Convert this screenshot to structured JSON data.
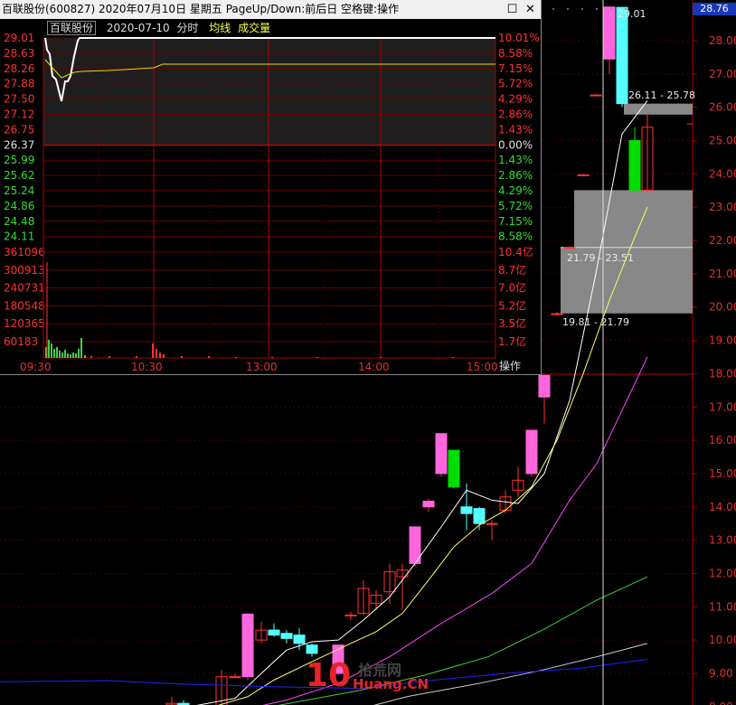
{
  "main_chart": {
    "price_axis_labels": [
      "28.00",
      "27.00",
      "26.00",
      "25.00",
      "24.00",
      "23.00",
      "22.00",
      "21.00",
      "20.00",
      "19.00",
      "18.00",
      "17.00",
      "16.00",
      "15.00",
      "14.00",
      "13.00",
      "12.00",
      "11.00",
      "10.00",
      "9.00",
      "8.00"
    ],
    "current_price_tag": "28.76",
    "high_label": "29.01",
    "range_labels": [
      "26.11 - 25.78",
      "21.79 - 23.51",
      "19.81 - 21.79"
    ],
    "colors": {
      "up": "#ff3232",
      "up_fill": "#ff66dd",
      "down": "#54ffff",
      "down_fill": "#00dd00",
      "ma5": "#ffffff",
      "ma10": "#ffff66",
      "ma20": "#ff44ff",
      "ma60": "#44cc44",
      "ma120": "#cccccc",
      "ma250": "#2222ff"
    }
  },
  "popup": {
    "title": "百联股份(600827) 2020年07月10日 星期五 PageUp/Down:前后日 空格键:操作",
    "min_button": "☐",
    "close_button": "✕",
    "stock_name": "百联股份",
    "date": "2020-07-10",
    "chart_kind": "分时",
    "avg_line_label": "均线",
    "volume_label": "成交量",
    "price_labels": [
      "29.01",
      "28.63",
      "28.26",
      "27.88",
      "27.50",
      "27.12",
      "26.75",
      "26.37",
      "25.99",
      "25.62",
      "25.24",
      "24.86",
      "24.48",
      "24.11"
    ],
    "pct_labels": [
      "10.01%",
      "8.58%",
      "7.15%",
      "5.72%",
      "4.29%",
      "2.86%",
      "1.43%",
      "0.00%",
      "1.43%",
      "2.86%",
      "4.29%",
      "5.72%",
      "7.15%",
      "8.58%"
    ],
    "volume_labels": [
      "361096",
      "300913",
      "240731",
      "180548",
      "120365",
      "60183"
    ],
    "amount_labels": [
      "10.4亿",
      "8.7亿",
      "7.0亿",
      "5.2亿",
      "3.5亿",
      "1.7亿"
    ],
    "time_labels": [
      "09:30",
      "10:30",
      "13:00",
      "14:00",
      "15:00"
    ],
    "op_button": "操作"
  },
  "watermark": {
    "number": "10",
    "cn": "拾荒网",
    "en": "Huang.CN"
  }
}
